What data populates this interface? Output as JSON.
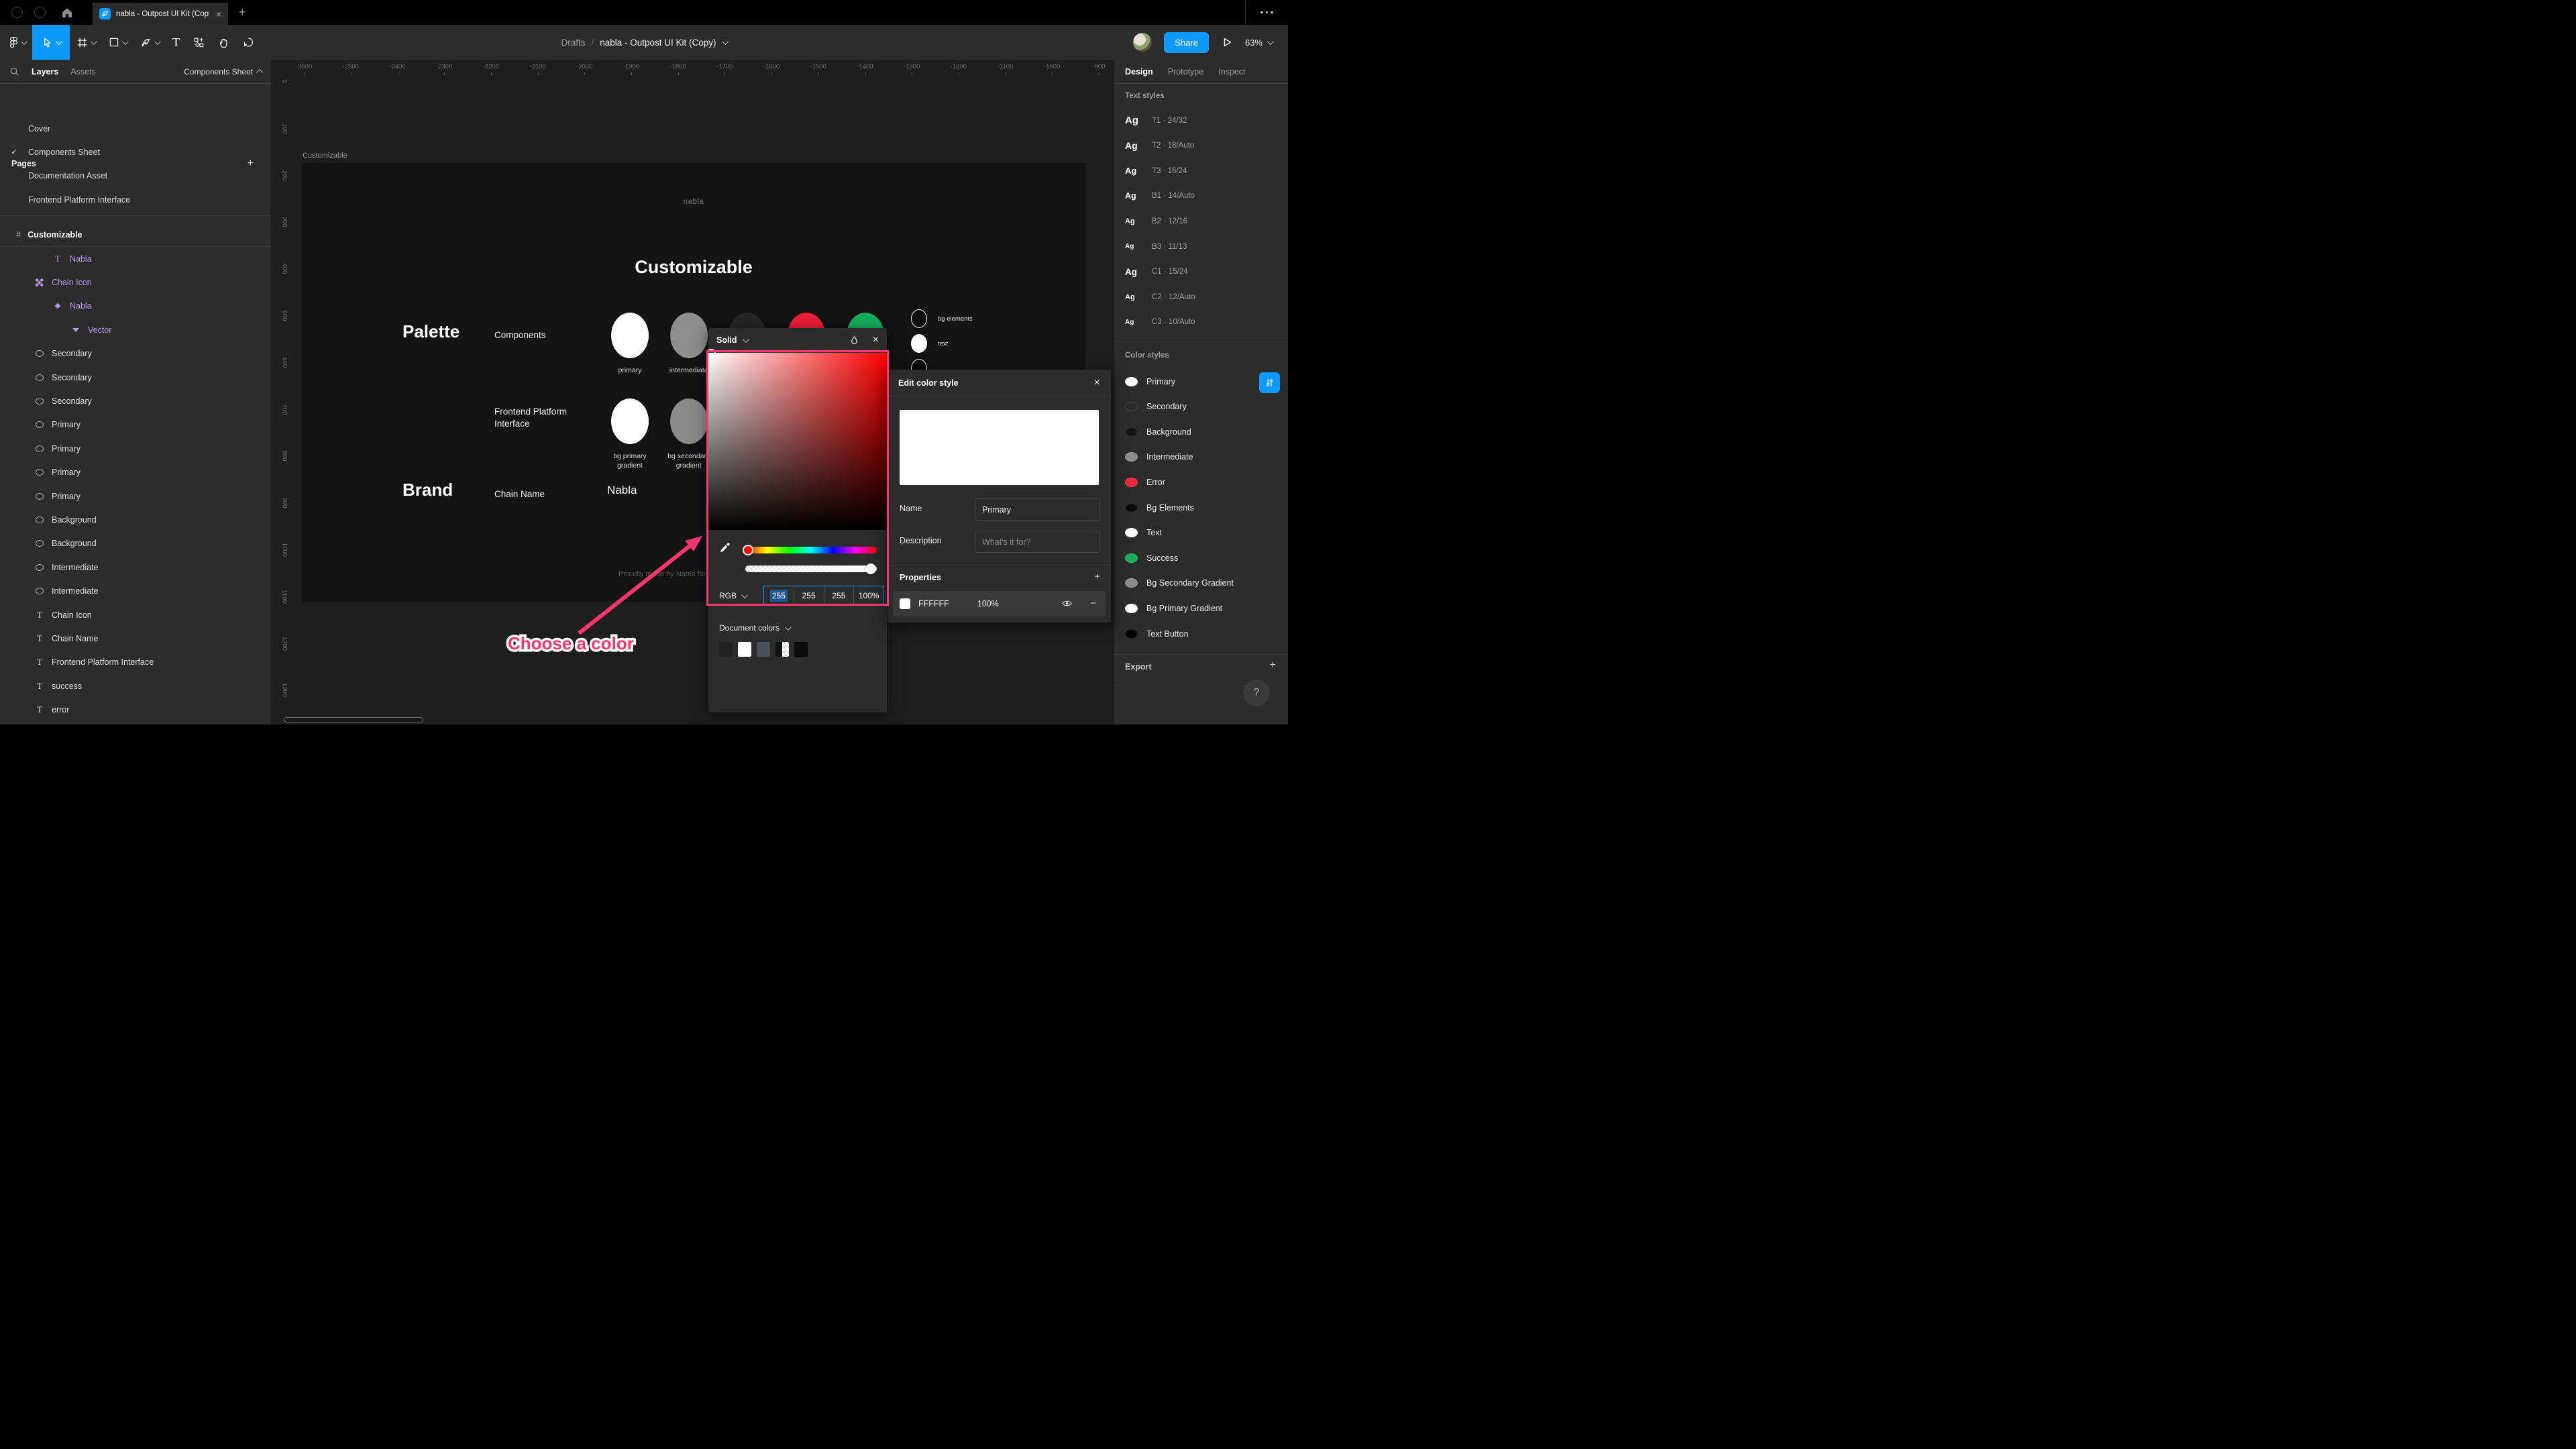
{
  "icons": {
    "close": "×",
    "plus": "+",
    "minus": "−",
    "check": "✓",
    "hash": "#",
    "text_tool": "T",
    "question": "?"
  },
  "chrome": {
    "tab_title": "nabla - Outpost UI Kit (Copy)"
  },
  "toolbar": {
    "breadcrumb_root": "Drafts",
    "breadcrumb_sep": "/",
    "file_name": "nabla - Outpost UI Kit (Copy)",
    "share_label": "Share",
    "zoom_level": "63%"
  },
  "left_panel": {
    "tab_layers": "Layers",
    "tab_assets": "Assets",
    "page_selector": "Components Sheet",
    "pages_title": "Pages",
    "pages": [
      {
        "check": "",
        "label": "Cover"
      },
      {
        "check": "✓",
        "label": "Components Sheet"
      },
      {
        "check": "",
        "label": "Documentation Asset"
      },
      {
        "check": "",
        "label": "Frontend Platform Interface"
      }
    ],
    "root_layer": "Customizable",
    "layers": [
      {
        "icon": "T",
        "label": "Nabla",
        "tone": "purple",
        "ind": 77
      },
      {
        "icon": "component",
        "label": "Chain Icon",
        "tone": "purple",
        "ind": 50
      },
      {
        "icon": "diamond",
        "label": "Nabla",
        "tone": "purple",
        "ind": 77
      },
      {
        "icon": "vector",
        "label": "Vector",
        "tone": "purple",
        "ind": 104
      },
      {
        "icon": "ellipse",
        "label": "Secondary",
        "tone": "",
        "ind": 50
      },
      {
        "icon": "ellipse",
        "label": "Secondary",
        "tone": "",
        "ind": 50
      },
      {
        "icon": "ellipse",
        "label": "Secondary",
        "tone": "",
        "ind": 50
      },
      {
        "icon": "ellipse",
        "label": "Primary",
        "tone": "",
        "ind": 50
      },
      {
        "icon": "ellipse",
        "label": "Primary",
        "tone": "",
        "ind": 50
      },
      {
        "icon": "ellipse",
        "label": "Primary",
        "tone": "",
        "ind": 50
      },
      {
        "icon": "ellipse",
        "label": "Primary",
        "tone": "",
        "ind": 50
      },
      {
        "icon": "ellipse",
        "label": "Background",
        "tone": "",
        "ind": 50
      },
      {
        "icon": "ellipse",
        "label": "Background",
        "tone": "",
        "ind": 50
      },
      {
        "icon": "ellipse",
        "label": "Intermediate",
        "tone": "",
        "ind": 50
      },
      {
        "icon": "ellipse",
        "label": "Intermediate",
        "tone": "",
        "ind": 50
      },
      {
        "icon": "T",
        "label": "Chain Icon",
        "tone": "",
        "ind": 50
      },
      {
        "icon": "T",
        "label": "Chain Name",
        "tone": "",
        "ind": 50
      },
      {
        "icon": "T",
        "label": "Frontend Platform Interface",
        "tone": "",
        "ind": 50
      },
      {
        "icon": "T",
        "label": "success",
        "tone": "",
        "ind": 50
      },
      {
        "icon": "T",
        "label": "error",
        "tone": "",
        "ind": 50
      }
    ]
  },
  "canvas": {
    "frame_label": "Customizable",
    "logo": "nabla",
    "title": "Customizable",
    "ruler_h": [
      "-2600",
      "-2500",
      "-2400",
      "-2300",
      "-2200",
      "-2100",
      "-2000",
      "-1900",
      "-1800",
      "-1700",
      "-1600",
      "-1500",
      "-1400",
      "-1300",
      "-1200",
      "-1100",
      "-1000",
      "-900"
    ],
    "ruler_v": [
      "0",
      "100",
      "200",
      "300",
      "400",
      "500",
      "600",
      "700",
      "800",
      "900",
      "1000",
      "1100",
      "1200",
      "1300"
    ],
    "palette_heading": "Palette",
    "components_label": "Components",
    "row2_label": "Frontend Platform\nInterface",
    "swatches": [
      {
        "label": "primary",
        "color": "#ffffff"
      },
      {
        "label": "intermediate",
        "color": "#8e8e8e"
      },
      {
        "label": "",
        "color": "#262626"
      },
      {
        "label": "",
        "color": "#ee1f38"
      },
      {
        "label": "",
        "color": "#14ae5c"
      }
    ],
    "swatches2": [
      {
        "label": "bg primary gradient",
        "color": "#ffffff"
      },
      {
        "label": "bg secondary gradient",
        "color": "#8a8a8a"
      }
    ],
    "mini": [
      {
        "label": "bg elements",
        "color": "#0d0d0d"
      },
      {
        "label": "text",
        "color": "#ffffff"
      },
      {
        "label": "",
        "color": "#060606"
      }
    ],
    "brand_heading": "Brand",
    "brand_row_label": "Chain Name",
    "brand_value": "Nabla",
    "footer": "Proudly made by Nabla for the whole Cosmos"
  },
  "picker": {
    "mode": "Solid",
    "color_model": "RGB",
    "r": "255",
    "g": "255",
    "b": "255",
    "a": "100%",
    "doc_colors_label": "Document colors",
    "doc_swatches": [
      "#222222",
      "#ffffff",
      "#495059",
      "half",
      "#0b0b0b"
    ]
  },
  "edit_style": {
    "title": "Edit color style",
    "name_label": "Name",
    "name_value": "Primary",
    "desc_label": "Description",
    "desc_placeholder": "What's it for?",
    "properties_label": "Properties",
    "hex": "FFFFFF",
    "opacity": "100%"
  },
  "right_panel": {
    "tabs": [
      "Design",
      "Prototype",
      "Inspect"
    ],
    "text_styles_title": "Text styles",
    "text_styles": [
      {
        "sample": "Ag",
        "label": "T1 · 24/32",
        "size": 15
      },
      {
        "sample": "Ag",
        "label": "T2 · 18/Auto",
        "size": 14
      },
      {
        "sample": "Ag",
        "label": "T3 · 16/24",
        "size": 13
      },
      {
        "sample": "Ag",
        "label": "B1 · 14/Auto",
        "size": 12.5
      },
      {
        "sample": "Ag",
        "label": "B2 · 12/16",
        "size": 11
      },
      {
        "sample": "Ag",
        "label": "B3 · 11/13",
        "size": 10
      },
      {
        "sample": "Ag",
        "label": "C1 · 15/24",
        "size": 13.5
      },
      {
        "sample": "Ag",
        "label": "C2 · 12/Auto",
        "size": 11
      },
      {
        "sample": "Ag",
        "label": "C3 · 10/Auto",
        "size": 10
      }
    ],
    "color_styles_title": "Color styles",
    "color_styles": [
      {
        "name": "Primary",
        "color": "#ffffff"
      },
      {
        "name": "Secondary",
        "color": "#2b2b2b"
      },
      {
        "name": "Background",
        "color": "#141414"
      },
      {
        "name": "Intermediate",
        "color": "#8c8c8c"
      },
      {
        "name": "Error",
        "color": "#f1263c"
      },
      {
        "name": "Bg Elements",
        "color": "#0d0d0d"
      },
      {
        "name": "Text",
        "color": "#ffffff"
      },
      {
        "name": "Success",
        "color": "#15ae5c"
      },
      {
        "name": "Bg Secondary Gradient",
        "color": "#8a8a8a"
      },
      {
        "name": "Bg Primary Gradient",
        "color": "#ffffff"
      },
      {
        "name": "Text Button",
        "color": "#000000"
      }
    ],
    "export_label": "Export"
  },
  "annotation": {
    "label": "Choose a color",
    "accent": "#f5366e"
  },
  "accent_blue": "#0d99ff"
}
